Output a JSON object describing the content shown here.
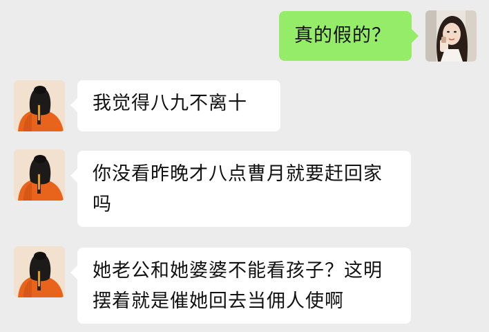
{
  "messages": [
    {
      "side": "out",
      "sender": "me",
      "text": "真的假的？"
    },
    {
      "side": "in",
      "sender": "friend",
      "text": "我觉得八九不离十"
    },
    {
      "side": "in",
      "sender": "friend",
      "text": "你没看昨晚才八点曹月就要赶回家吗"
    },
    {
      "side": "in",
      "sender": "friend",
      "text": "她老公和她婆婆不能看孩子？这明摆着就是催她回去当佣人使啊"
    }
  ],
  "colors": {
    "background": "#ececec",
    "outgoing_bubble": "#95ec69",
    "incoming_bubble": "#ffffff",
    "friend_avatar_bg": "#f3e1cf",
    "friend_avatar_jacket": "#e8641c"
  },
  "avatars": {
    "me": "woman-selfie-avatar",
    "friend": "orange-jacket-person-avatar"
  }
}
